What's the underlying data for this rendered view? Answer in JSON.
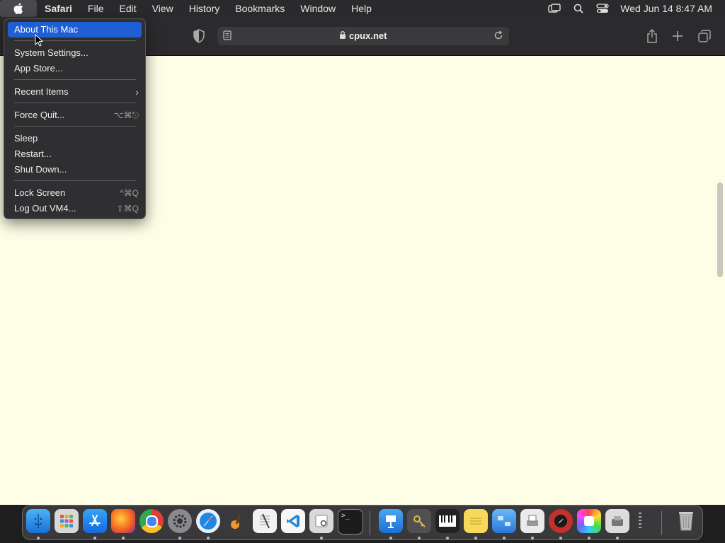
{
  "menubar": {
    "app": "Safari",
    "items": [
      "File",
      "Edit",
      "View",
      "History",
      "Bookmarks",
      "Window",
      "Help"
    ],
    "clock": "Wed Jun 14  8:47 AM"
  },
  "browser": {
    "url": "cpux.net",
    "background": "#fefee6"
  },
  "apple_menu": {
    "about": "About This Mac",
    "system_settings": "System Settings...",
    "app_store": "App Store...",
    "recent_items": "Recent Items",
    "force_quit": "Force Quit...",
    "force_quit_shortcut": "⌥⌘⎋",
    "sleep": "Sleep",
    "restart": "Restart...",
    "shut_down": "Shut Down...",
    "lock_screen": "Lock Screen",
    "lock_screen_shortcut": "^⌘Q",
    "log_out": "Log Out VM4...",
    "log_out_shortcut": "⇧⌘Q"
  },
  "dock": {
    "apps": [
      "finder-icon",
      "launchpad-icon",
      "app-store-icon",
      "firefox-icon",
      "chrome-icon",
      "system-settings-icon",
      "safari-icon",
      "garageband-icon",
      "textedit-icon",
      "vscode-icon",
      "preview-icon",
      "terminal-icon",
      "keynote-icon",
      "keychain-icon",
      "piano-icon",
      "notes-icon",
      "finder-alt-icon",
      "scanner-icon",
      "compass-icon",
      "color-picker-icon",
      "disk-utility-icon",
      "more-icon",
      "trash-icon"
    ]
  },
  "colors": {
    "accent": "#1f5fd6",
    "menubar": "#2a2a2c",
    "menu": "#2f2f31"
  }
}
